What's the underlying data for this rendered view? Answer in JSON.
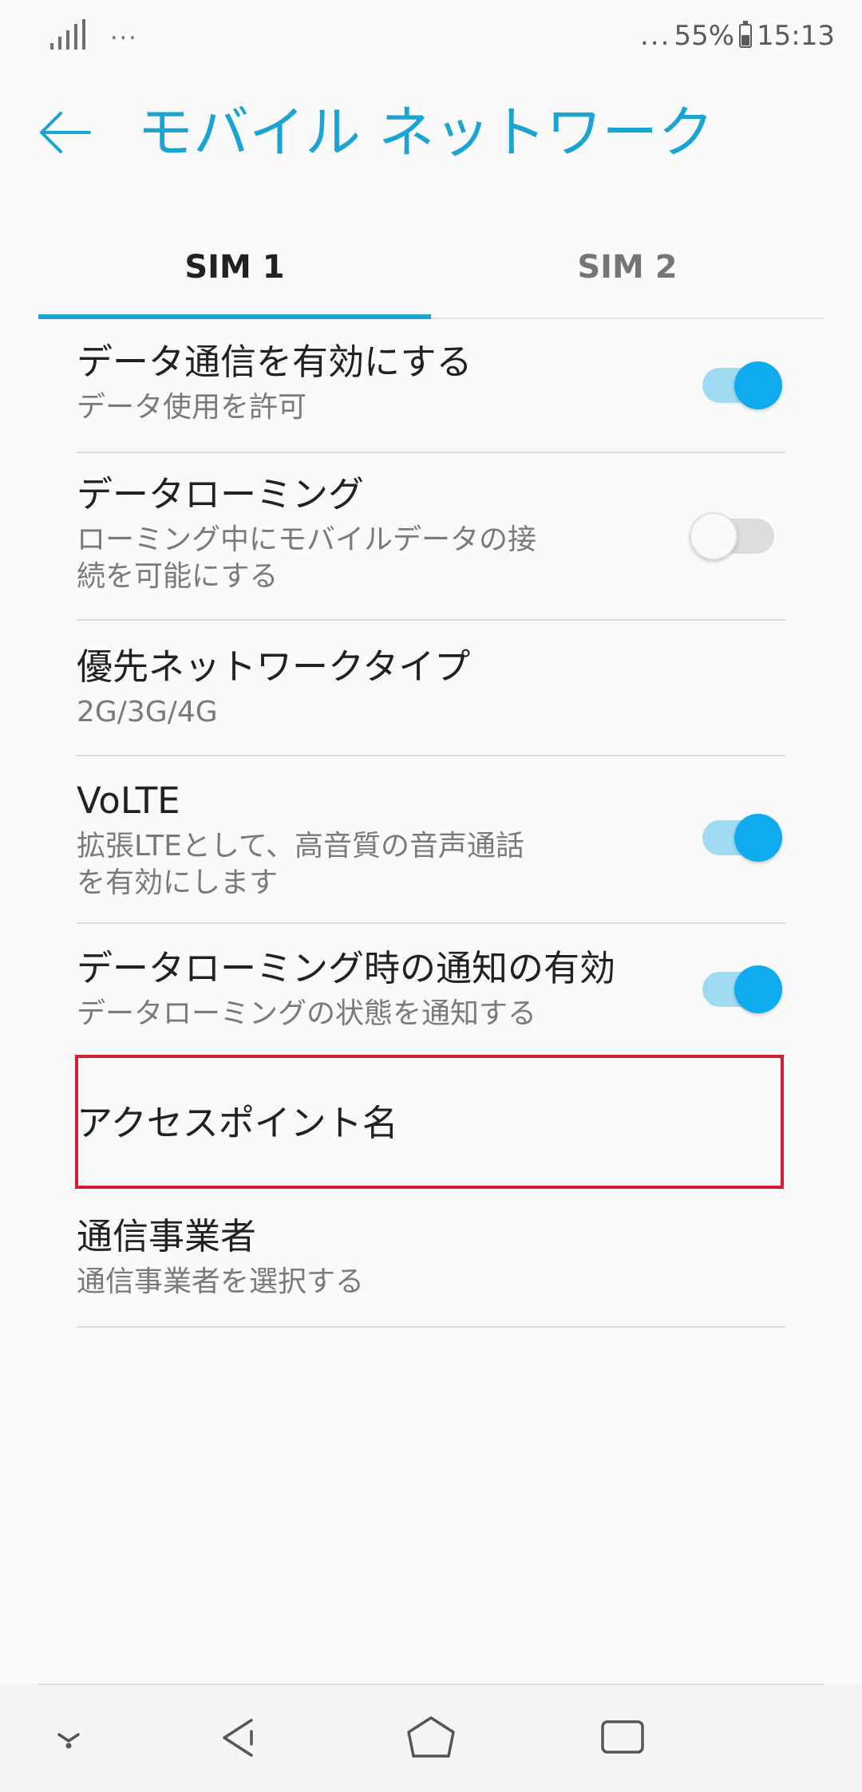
{
  "status_bar": {
    "left_dots": "...",
    "right_dots": "...",
    "battery_percent": "55%",
    "battery_level": 0.55,
    "time": "15:13"
  },
  "app_bar": {
    "title": "モバイル ネットワーク",
    "back_icon": "arrow-back-icon"
  },
  "tabs": [
    {
      "label": "SIM 1",
      "selected": true
    },
    {
      "label": "SIM 2",
      "selected": false
    }
  ],
  "settings": [
    {
      "title": "データ通信を有効にする",
      "summary": "データ使用を許可",
      "toggle": true
    },
    {
      "title": "データローミング",
      "summary_lines": [
        "ローミング中にモバイルデータの接",
        "続を可能にする"
      ],
      "toggle": false
    },
    {
      "title": "優先ネットワークタイプ",
      "summary": "2G/3G/4G"
    },
    {
      "title": "VoLTE",
      "summary_lines": [
        "拡張LTEとして、高音質の音声通話",
        "を有効にします"
      ],
      "toggle": true
    },
    {
      "title": "データローミング時の通知の有効",
      "summary": "データローミングの状態を通知する",
      "toggle": true
    },
    {
      "title": "アクセスポイント名"
    },
    {
      "title": "通信事業者",
      "summary": "通信事業者を選択する"
    }
  ],
  "colors": {
    "accent": "#1aa4d4",
    "toggle_on": "#10aaee",
    "highlight": "#d2202f"
  },
  "nav_bar": {
    "icons": [
      "collapse-icon",
      "back-triangle-icon",
      "home-icon",
      "recents-icon"
    ]
  }
}
